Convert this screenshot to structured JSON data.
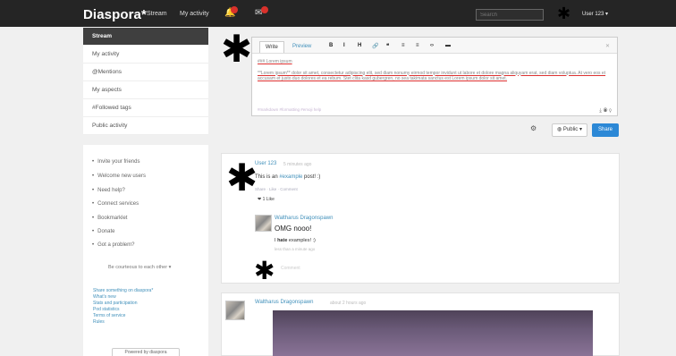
{
  "header": {
    "brand": "Diaspora*",
    "nav": [
      "Stream",
      "My activity"
    ],
    "search_placeholder": "Search",
    "user_menu": "User 123 ▾",
    "notification_icon": "bell-icon",
    "conversation_icon": "mail-icon"
  },
  "sidebar": {
    "items": [
      {
        "label": "Stream",
        "active": true
      },
      {
        "label": "My activity"
      },
      {
        "label": "@Mentions"
      },
      {
        "label": "My aspects"
      },
      {
        "label": "#Followed tags"
      },
      {
        "label": "Public activity"
      }
    ],
    "links": [
      "Invite your friends",
      "Welcome new users",
      "Need help?",
      "Connect services",
      "Bookmarklet",
      "Donate",
      "Got a problem?"
    ],
    "dropdown": "Be courteous to each other ▾",
    "bottom_links": [
      "Share something on diaspora*",
      "What's new",
      "Stats and participation",
      "Pod statistics",
      "Terms of service",
      "Rules"
    ],
    "bottom_button": "Powered by diaspora"
  },
  "composer": {
    "tabs": [
      "Write",
      "Preview"
    ],
    "tools": [
      "B",
      "I",
      "H",
      "🔗",
      "❝",
      "≡",
      "≡",
      "‹›",
      "▬"
    ],
    "close": "✕",
    "heading": "### Lorem ipsum",
    "body": "**Lorem ipsum** dolor sit amet, consectetur adipiscing elit, sed diam nonumy eirmod tempor invidunt ut labore et dolore magna aliquyam erat, sed diam voluptua. At vero eos et accusam et justo duo dolores et ea rebum. Stet clita kasd gubergren, no sea takimata sanctus est Lorem ipsum dolor sit amet.",
    "hint": "#markdown   #formatting   #emoji   help",
    "icons": "⤓  ◉  ⚲",
    "aspect_button": "◍ Public ▾",
    "share_button": "Share",
    "settings_icon": "gear-icon"
  },
  "posts": [
    {
      "author": "User 123",
      "time": "5 minutes ago",
      "text_before": "This is an ",
      "tag": "#example",
      "text_after": " post! :)",
      "actions": "Share · Like · Comment",
      "likes": "❤ 1 Like",
      "comment": {
        "author": "Waltharus Dragonspawn",
        "text": "OMG nooo!",
        "sub_before": "I ",
        "sub_bold": "hate",
        "sub_after": " examples! :)",
        "meta": "less than a minute ago"
      },
      "comment_placeholder": "Comment"
    },
    {
      "author": "Waltharus Dragonspawn",
      "time": "about 2 hours ago"
    }
  ]
}
